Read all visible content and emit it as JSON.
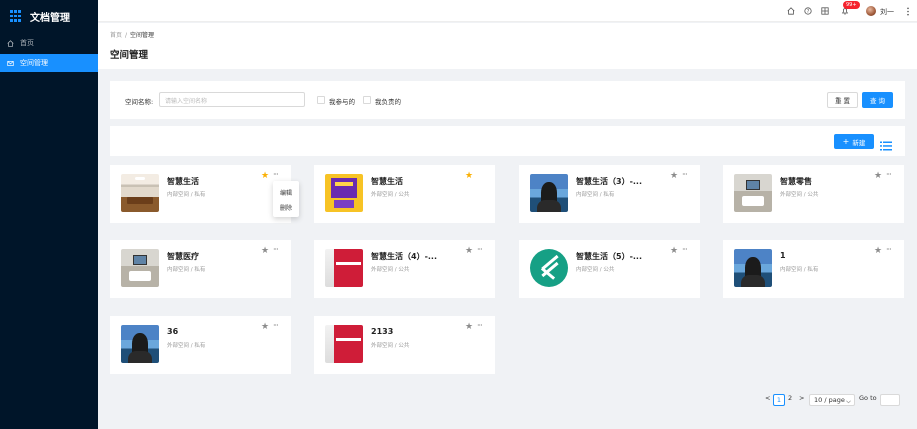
{
  "app": {
    "title": "文档管理"
  },
  "sidebar": {
    "items": [
      {
        "label": "首页",
        "icon": "home-icon"
      },
      {
        "label": "空间管理",
        "icon": "mail-icon",
        "active": true
      }
    ]
  },
  "header": {
    "notify_badge": "99+",
    "user_name": "刘一"
  },
  "breadcrumb": {
    "home": "首页",
    "separator": "/",
    "current": "空间管理"
  },
  "page": {
    "title": "空间管理"
  },
  "filter": {
    "label": "空间名称:",
    "placeholder": "请输入空间名称",
    "checkbox_joined": "我参与的",
    "checkbox_owned": "我负责的",
    "reset_label": "重 置",
    "search_label": "查 询"
  },
  "toolbar": {
    "new_label": "新建"
  },
  "cards": [
    {
      "title": "智慧生活",
      "subtitle": "内部空间 / 私有",
      "starred": true,
      "thumb": "room"
    },
    {
      "title": "智慧生活",
      "subtitle": "外部空间 / 公共",
      "starred": true,
      "thumb": "yellow"
    },
    {
      "title": "智慧生活（3）-...",
      "subtitle": "内部空间 / 私有",
      "starred": false,
      "thumb": "person"
    },
    {
      "title": "智慧零售",
      "subtitle": "外部空间 / 公共",
      "starred": false,
      "thumb": "meeting"
    },
    {
      "title": "智慧医疗",
      "subtitle": "内部空间 / 私有",
      "starred": false,
      "thumb": "meeting"
    },
    {
      "title": "智慧生活（4）-...",
      "subtitle": "外部空间 / 公共",
      "starred": false,
      "thumb": "red"
    },
    {
      "title": "智慧生活（5）-...",
      "subtitle": "内部空间 / 公共",
      "starred": false,
      "thumb": "logo"
    },
    {
      "title": "1",
      "subtitle": "内部空间 / 私有",
      "starred": false,
      "thumb": "person"
    },
    {
      "title": "36",
      "subtitle": "外部空间 / 私有",
      "starred": false,
      "thumb": "person"
    },
    {
      "title": "2133",
      "subtitle": "外部空间 / 公共",
      "starred": false,
      "thumb": "red"
    }
  ],
  "card_menu": {
    "edit": "编辑",
    "delete": "删除"
  },
  "pagination": {
    "prev": "<",
    "page1": "1",
    "page2": "2",
    "next": ">",
    "page_size": "10 / page",
    "goto_label": "Go to",
    "current_page": 1
  },
  "colors": {
    "primary": "#1890ff",
    "sidebar_bg": "#001529",
    "star_active": "#fab005"
  }
}
